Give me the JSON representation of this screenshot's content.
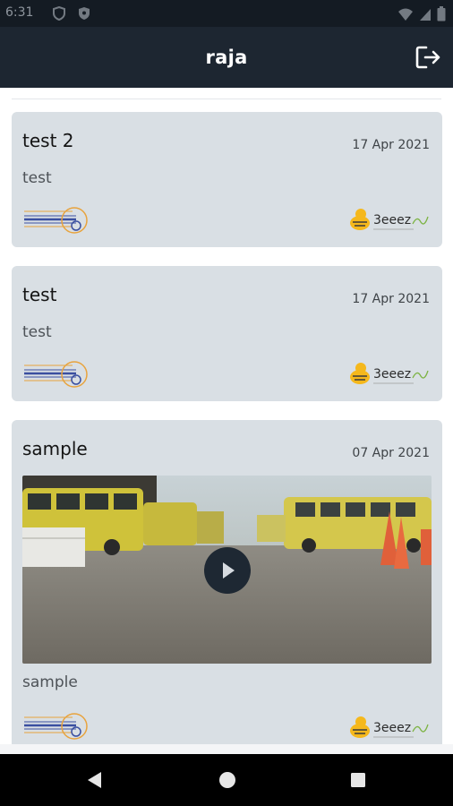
{
  "status_bar": {
    "time": "6:31"
  },
  "header": {
    "title": "raja",
    "logout_icon": "logout-icon"
  },
  "posts": [
    {
      "title": "test 2",
      "date": "17 Apr 2021",
      "text": "test",
      "has_video": false
    },
    {
      "title": "test",
      "date": "17 Apr 2021",
      "text": "test",
      "has_video": false
    },
    {
      "title": "sample",
      "date": "07 Apr 2021",
      "text": "sample",
      "has_video": true
    }
  ],
  "logos": {
    "right_brand": "3eeez"
  },
  "colors": {
    "app_bar": "#1d2631",
    "card": "#d9dfe4",
    "status_bar": "#141b23"
  }
}
